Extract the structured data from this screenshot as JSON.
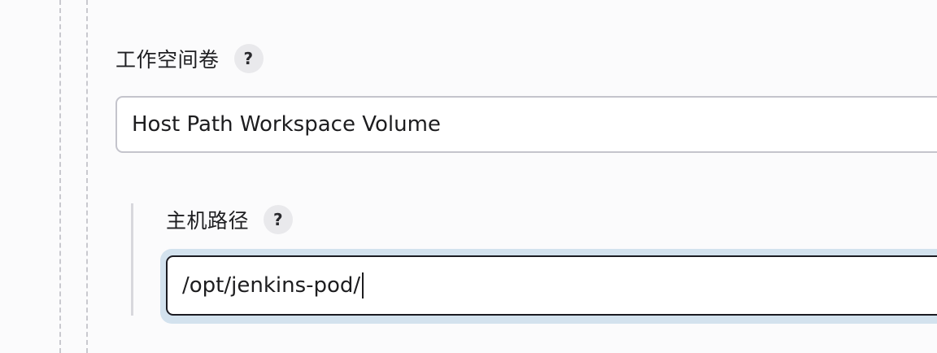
{
  "workspace_volume": {
    "label": "工作空间卷",
    "help_icon": "question-mark",
    "selected_value": "Host Path Workspace Volume"
  },
  "host_path": {
    "label": "主机路径",
    "help_icon": "question-mark",
    "value": "/opt/jenkins-pod/"
  },
  "colors": {
    "focus_ring": "#d3e2ee",
    "input_border_focused": "#1b1b22",
    "input_border": "#c4c4cc"
  }
}
